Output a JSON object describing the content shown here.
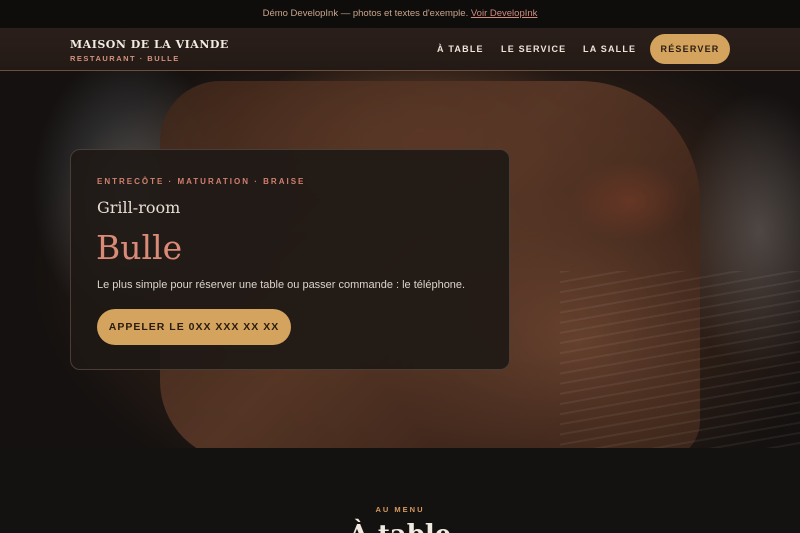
{
  "demo_bar": {
    "text": "Démo DevelopInk — photos et textes d'exemple.",
    "link": "Voir DevelopInk"
  },
  "header": {
    "brand_name": "MAISON DE LA VIANDE",
    "brand_sub": "RESTAURANT · BULLE",
    "nav": [
      "À TABLE",
      "LE SERVICE",
      "LA SALLE"
    ],
    "cta": "RÉSERVER"
  },
  "hero": {
    "eyebrow": "ENTRECÔTE · MATURATION · BRAISE",
    "subtitle": "Grill-room",
    "title": "Bulle",
    "text": "Le plus simple pour réserver une table ou passer commande : le téléphone.",
    "cta": "APPELER LE 0XX XXX XX XX"
  },
  "menu": {
    "eyebrow": "AU MENU",
    "title": "À table"
  },
  "colors": {
    "accent_gold": "#d4a35e",
    "accent_rose": "#db8a78",
    "background": "#141210"
  }
}
